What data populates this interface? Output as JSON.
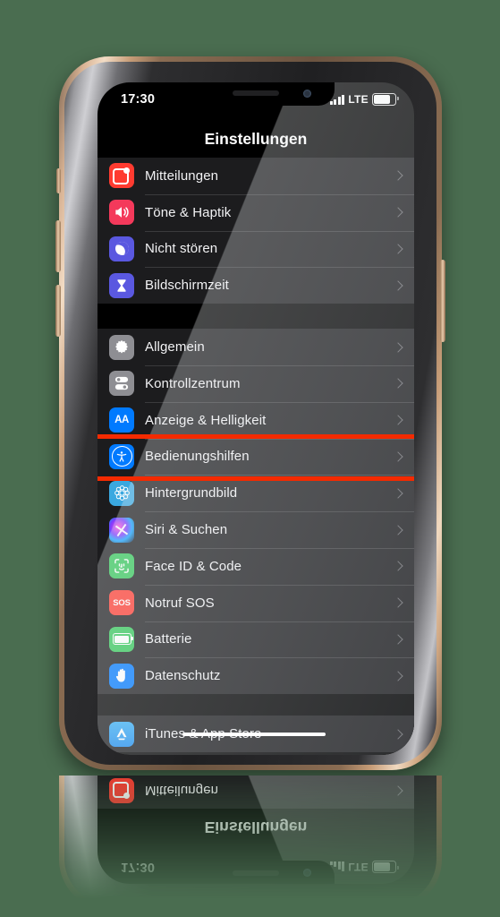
{
  "background_color": "#4a6d50",
  "device": {
    "name": "iphone-x-gold",
    "frame_color": "#c79d78",
    "side_buttons": [
      "mute-switch",
      "volume-up-button",
      "volume-down-button",
      "power-button"
    ]
  },
  "status_bar": {
    "time": "17:30",
    "signal_icon": "cellular-signal-icon",
    "network": "LTE",
    "battery_icon": "battery-icon",
    "battery_level": 70
  },
  "nav": {
    "title": "Einstellungen"
  },
  "highlight": {
    "color": "#f42a00",
    "target_label": "Bedienungshilfen"
  },
  "groups": [
    {
      "id": "group-notifications",
      "rows": [
        {
          "label": "Mitteilungen",
          "icon": "notifications-icon",
          "icon_class": "ic-notify"
        },
        {
          "label": "Töne & Haptik",
          "icon": "sound-haptics-icon",
          "icon_class": "ic-sound"
        },
        {
          "label": "Nicht stören",
          "icon": "do-not-disturb-icon",
          "icon_class": "ic-dnd"
        },
        {
          "label": "Bildschirmzeit",
          "icon": "screen-time-icon",
          "icon_class": "ic-screentime"
        }
      ]
    },
    {
      "id": "group-system",
      "rows": [
        {
          "label": "Allgemein",
          "icon": "gear-icon",
          "icon_class": "ic-general"
        },
        {
          "label": "Kontrollzentrum",
          "icon": "control-center-icon",
          "icon_class": "ic-control"
        },
        {
          "label": "Anzeige & Helligkeit",
          "icon": "display-brightness-icon",
          "icon_class": "ic-display"
        },
        {
          "label": "Bedienungshilfen",
          "icon": "accessibility-icon",
          "icon_class": "ic-access"
        },
        {
          "label": "Hintergrundbild",
          "icon": "wallpaper-icon",
          "icon_class": "ic-wall"
        },
        {
          "label": "Siri & Suchen",
          "icon": "siri-icon",
          "icon_class": "ic-siri"
        },
        {
          "label": "Face ID & Code",
          "icon": "face-id-icon",
          "icon_class": "ic-faceid"
        },
        {
          "label": "Notruf SOS",
          "icon": "emergency-sos-icon",
          "icon_class": "ic-sos"
        },
        {
          "label": "Batterie",
          "icon": "battery-settings-icon",
          "icon_class": "ic-battery"
        },
        {
          "label": "Datenschutz",
          "icon": "privacy-hand-icon",
          "icon_class": "ic-privacy"
        }
      ]
    },
    {
      "id": "group-store",
      "rows": [
        {
          "label": "iTunes & App Store",
          "icon": "app-store-icon",
          "icon_class": "ic-itunes"
        }
      ]
    }
  ]
}
